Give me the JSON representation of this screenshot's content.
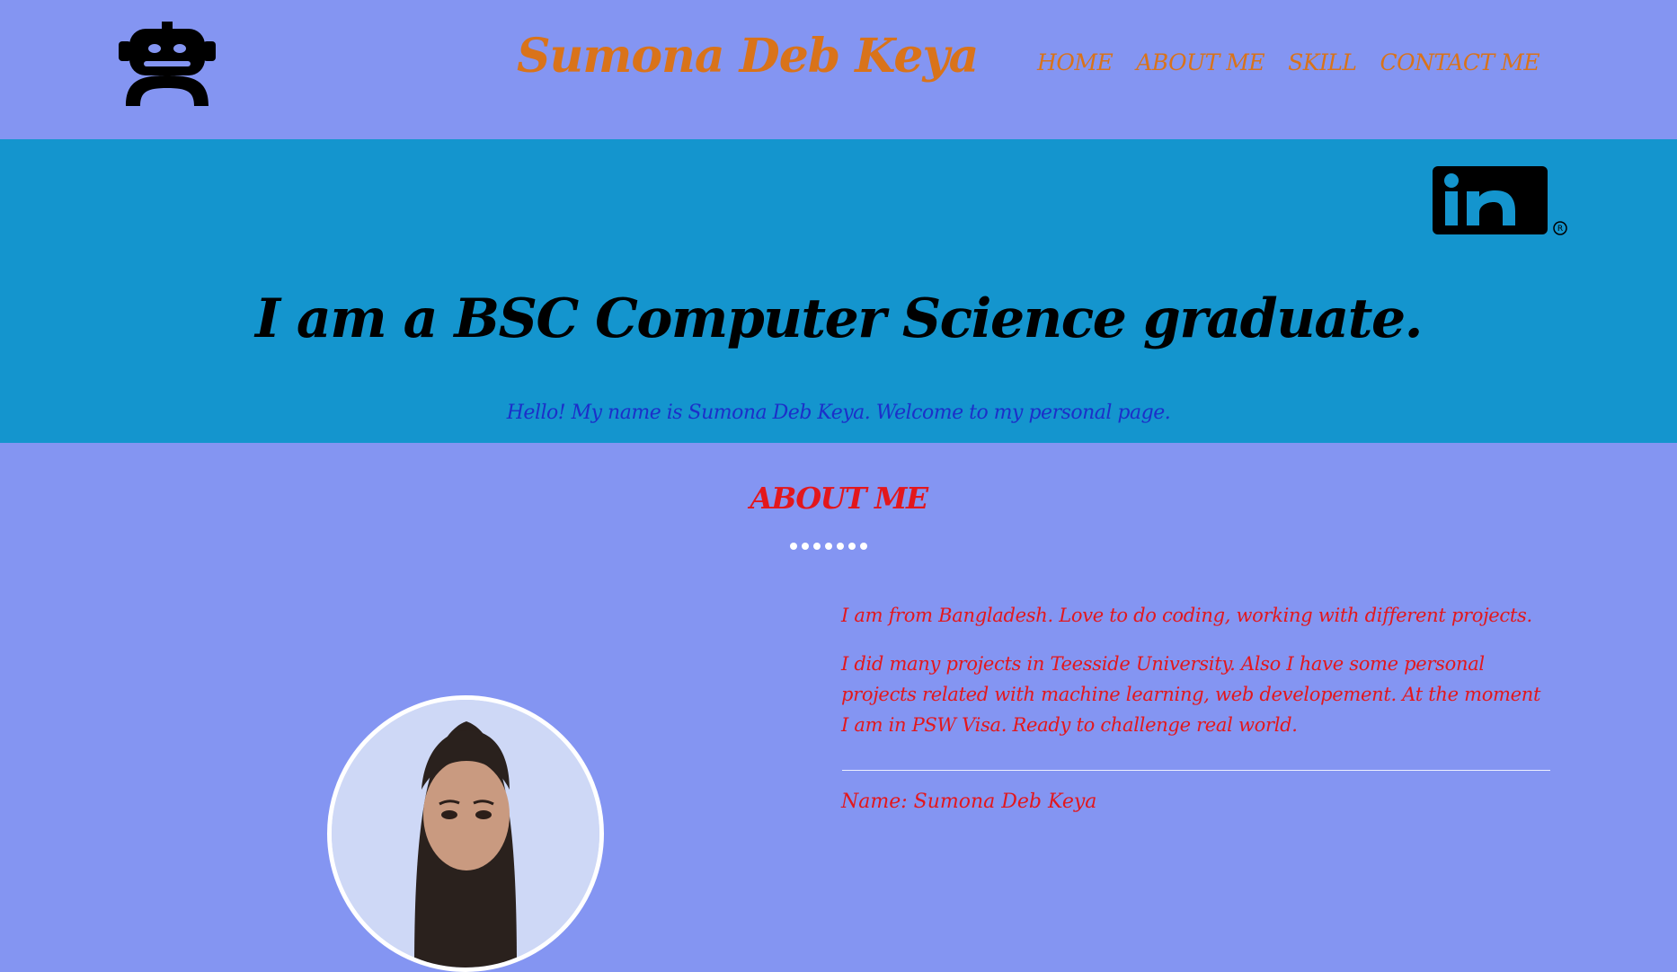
{
  "header": {
    "logo_icon": "robot-icon",
    "title": "Sumona Deb Keya",
    "nav": [
      {
        "label": "HOME"
      },
      {
        "label": "ABOUT ME"
      },
      {
        "label": "SKILL"
      },
      {
        "label": "CONTACT ME"
      }
    ]
  },
  "hero": {
    "linkedin_icon": "linkedin-icon",
    "title": "I am a BSC Computer Science graduate.",
    "subtitle": "Hello! My name is Sumona Deb Keya. Welcome to my personal page."
  },
  "about": {
    "heading": "ABOUT ME",
    "paragraphs": [
      "I am from Bangladesh. Love to do coding, working with different projects.",
      "I did many projects in Teesside University. Also I have some personal projects related with machine learning, web developement. At the moment I am in PSW Visa. Ready to challenge real world."
    ],
    "name_line": "Name: Sumona Deb Keya"
  },
  "colors": {
    "page_bg": "#8495f2",
    "hero_bg": "#1495ce",
    "accent_orange": "#d9731a",
    "accent_red": "#e3171c",
    "subtitle_blue": "#1c2fc9"
  }
}
